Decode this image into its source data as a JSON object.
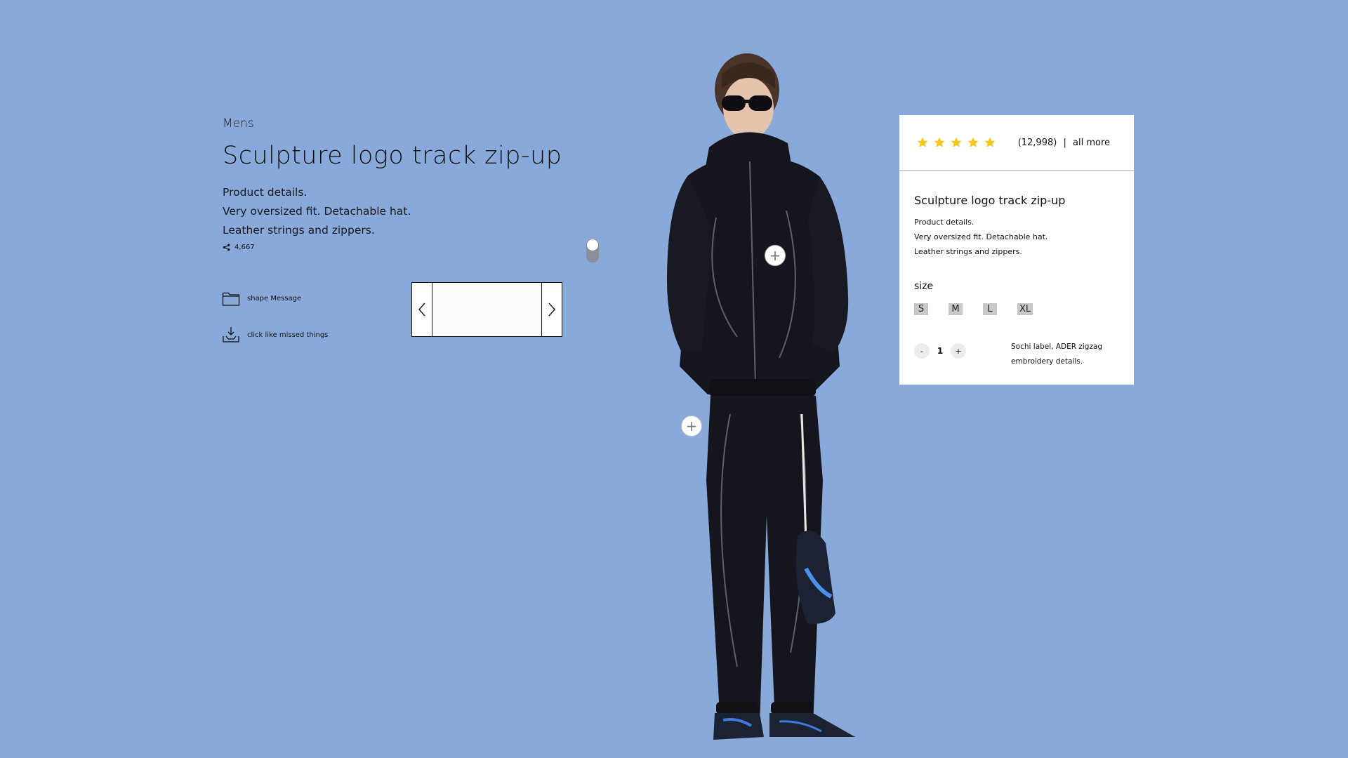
{
  "product": {
    "category": "Mens",
    "title": "Sculpture logo track zip-up",
    "details": [
      "Product details.",
      "Very oversized fit. Detachable hat.",
      "Leather strings and zippers."
    ],
    "share_count": "4,667"
  },
  "actions": {
    "message_label": "shape Message",
    "missed_label": "click like missed things"
  },
  "card": {
    "rating": 5,
    "reviews_count": "(12,998)",
    "reviews_separator": "|",
    "all_more_label": "all more",
    "title": "Sculpture logo track zip-up",
    "details": [
      "Product details.",
      "Very oversized fit. Detachable hat.",
      "Leather strings and zippers."
    ],
    "size_label": "size",
    "sizes": [
      "S",
      "M",
      "L",
      "XL"
    ],
    "quantity": {
      "minus": "-",
      "value": "1",
      "plus": "+"
    },
    "note": "Sochi label, ADER zigzag embroidery details."
  },
  "hotspots": {
    "symbol": "+"
  },
  "colors": {
    "background": "#89a9da",
    "star": "#f5c518",
    "garment": "#15151d"
  },
  "icons": {
    "share": "share-icon",
    "message": "folder-icon",
    "missed": "download-tray-icon",
    "prev": "chevron-left-icon",
    "next": "chevron-right-icon",
    "star": "star-icon"
  }
}
